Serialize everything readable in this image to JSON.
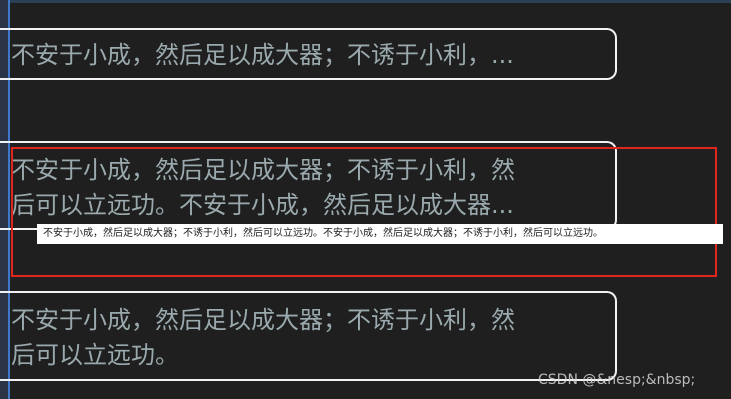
{
  "cards": {
    "card1": {
      "text": "不安于小成，然后足以成大器；不诱于小利，..."
    },
    "card2": {
      "line1": "不安于小成，然后足以成大器；不诱于小利，然",
      "line2": "后可以立远功。不安于小成，然后足以成大器..."
    },
    "card3": {
      "line1": "不安于小成，然后足以成大器；不诱于小利，然",
      "line2": "后可以立远功。"
    }
  },
  "tooltip": {
    "text": "不安于小成，然后足以成大器；不诱于小利，然后可以立远功。不安于小成，然后足以成大器；不诱于小利，然后可以立远功。"
  },
  "watermark": {
    "text": "CSDN @&nesp;&nbsp;"
  },
  "colors": {
    "background": "#1f1f1f",
    "card_border": "#f2f2f2",
    "card_text": "#9aa9ad",
    "highlight_border": "#e0271d",
    "tooltip_bg": "#ffffff",
    "tooltip_text": "#1c1c1c"
  }
}
